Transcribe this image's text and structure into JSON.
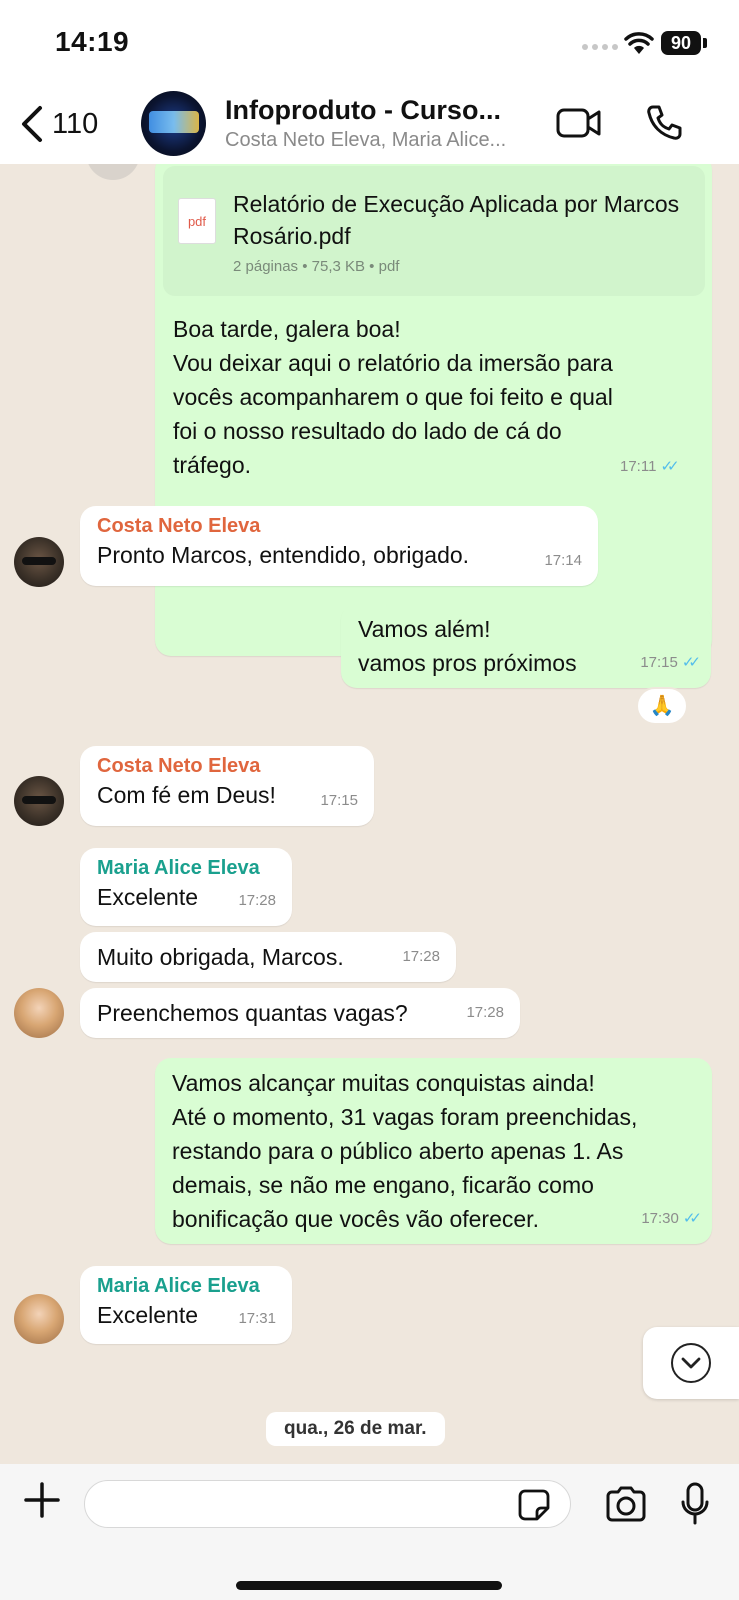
{
  "status": {
    "time": "14:19",
    "battery": "90"
  },
  "header": {
    "back_count": "110",
    "title": "Infoproduto - Curso...",
    "subtitle": "Costa Neto Eleva, Maria Alice..."
  },
  "attachment": {
    "type_label": "pdf",
    "name": "Relatório de Execução Aplicada por Marcos Rosário.pdf",
    "meta": "2 páginas • 75,3 KB • pdf"
  },
  "messages": [
    {
      "dir": "out",
      "text": [
        "Boa tarde, galera boa!",
        "Vou deixar aqui o relatório da imersão para",
        "vocês acompanharem o que foi feito e qual",
        "foi o nosso resultado do lado de cá do",
        "tráfego."
      ],
      "time": "17:11"
    },
    {
      "dir": "in",
      "sender": "Costa Neto Eleva",
      "text": [
        "Pronto Marcos, entendido, obrigado."
      ],
      "time": "17:14"
    },
    {
      "dir": "out",
      "text": [
        "Vamos além!",
        "vamos pros próximos"
      ],
      "time": "17:15",
      "reaction": "🙏"
    },
    {
      "dir": "in",
      "sender": "Costa Neto Eleva",
      "text": [
        "Com fé em Deus!"
      ],
      "time": "17:15"
    },
    {
      "dir": "in",
      "sender": "Maria Alice Eleva",
      "text": [
        "Excelente"
      ],
      "time": "17:28"
    },
    {
      "dir": "in",
      "text": [
        "Muito obrigada, Marcos."
      ],
      "time": "17:28"
    },
    {
      "dir": "in",
      "text": [
        "Preenchemos quantas vagas?"
      ],
      "time": "17:28"
    },
    {
      "dir": "out",
      "text": [
        "Vamos alcançar muitas conquistas ainda!",
        "Até o momento, 31 vagas foram preenchidas,",
        "restando para o público aberto apenas 1. As",
        "demais, se não me engano, ficarão como",
        "bonificação que vocês vão oferecer."
      ],
      "time": "17:30"
    },
    {
      "dir": "in",
      "sender": "Maria Alice Eleva",
      "text": [
        "Excelente"
      ],
      "time": "17:31"
    }
  ],
  "date_separator": "qua., 26 de mar.",
  "colors": {
    "outgoing": "#d9fdd3",
    "incoming": "#ffffff",
    "read_ticks": "#53bdeb",
    "sender_orange": "#e0663e",
    "sender_teal": "#1aa08e"
  }
}
